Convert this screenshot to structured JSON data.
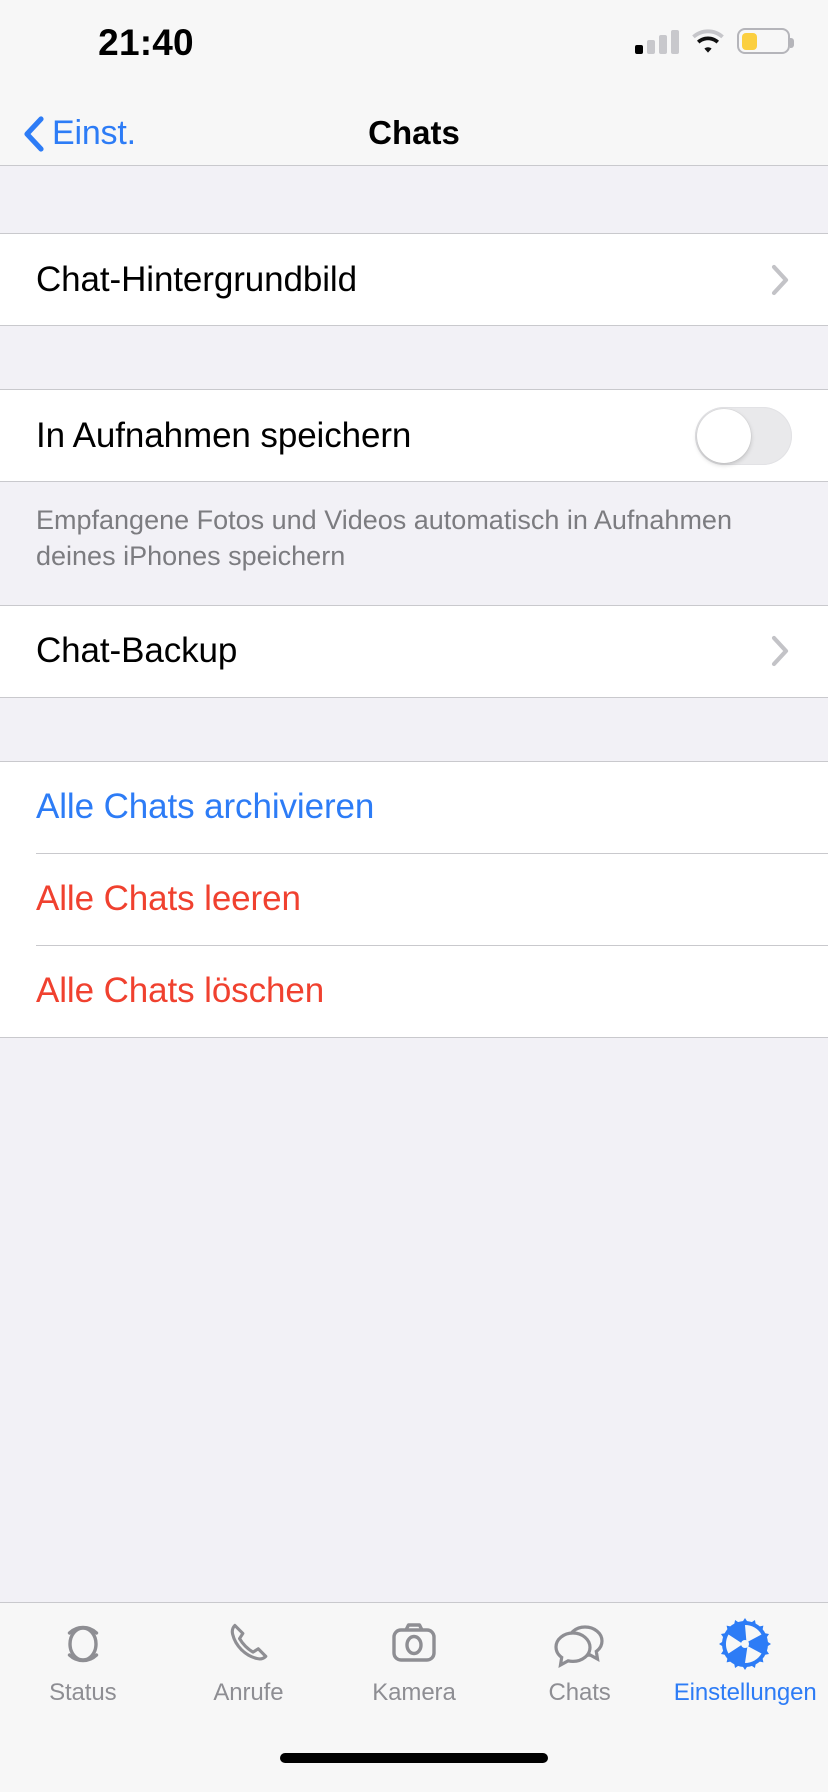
{
  "status_bar": {
    "time": "21:40",
    "cellular_icon": "signal-bars-icon",
    "cellular_bars_filled": 1,
    "cellular_bars_total": 4,
    "wifi_icon": "wifi-icon",
    "battery_icon": "battery-icon",
    "battery_level_percent": 35,
    "battery_color": "#fbcf40"
  },
  "nav": {
    "back_label": "Einst.",
    "back_icon": "chevron-left-icon",
    "title": "Chats",
    "accent_color": "#2d7cf6"
  },
  "sections": {
    "wallpaper": {
      "rows": [
        {
          "label": "Chat-Hintergrundbild",
          "accessory": "chevron-right-icon",
          "style": "default"
        }
      ]
    },
    "media": {
      "rows": [
        {
          "label": "In Aufnahmen speichern",
          "accessory": "toggle-switch",
          "toggle_on": false,
          "style": "default"
        }
      ],
      "footnote": "Empfangene Fotos und Videos automatisch in Aufnahmen deines iPhones speichern"
    },
    "backup": {
      "rows": [
        {
          "label": "Chat-Backup",
          "accessory": "chevron-right-icon",
          "style": "default"
        }
      ]
    },
    "actions": {
      "rows": [
        {
          "label": "Alle Chats archivieren",
          "accessory": "none",
          "style": "blue"
        },
        {
          "label": "Alle Chats leeren",
          "accessory": "none",
          "style": "red"
        },
        {
          "label": "Alle Chats löschen",
          "accessory": "none",
          "style": "red"
        }
      ]
    }
  },
  "colors": {
    "tint_blue": "#2d7cf6",
    "destructive_red": "#f0412f",
    "group_background": "#f2f1f6",
    "cell_background": "#ffffff",
    "footnote_gray": "#7c7c80"
  },
  "tab_bar": {
    "tabs": [
      {
        "label": "Status",
        "icon": "status-rings-icon",
        "active": false
      },
      {
        "label": "Anrufe",
        "icon": "phone-icon",
        "active": false
      },
      {
        "label": "Kamera",
        "icon": "camera-icon",
        "active": false
      },
      {
        "label": "Chats",
        "icon": "chat-bubbles-icon",
        "active": false
      },
      {
        "label": "Einstellungen",
        "icon": "gear-icon",
        "active": true
      }
    ]
  },
  "home_indicator": "home-indicator"
}
